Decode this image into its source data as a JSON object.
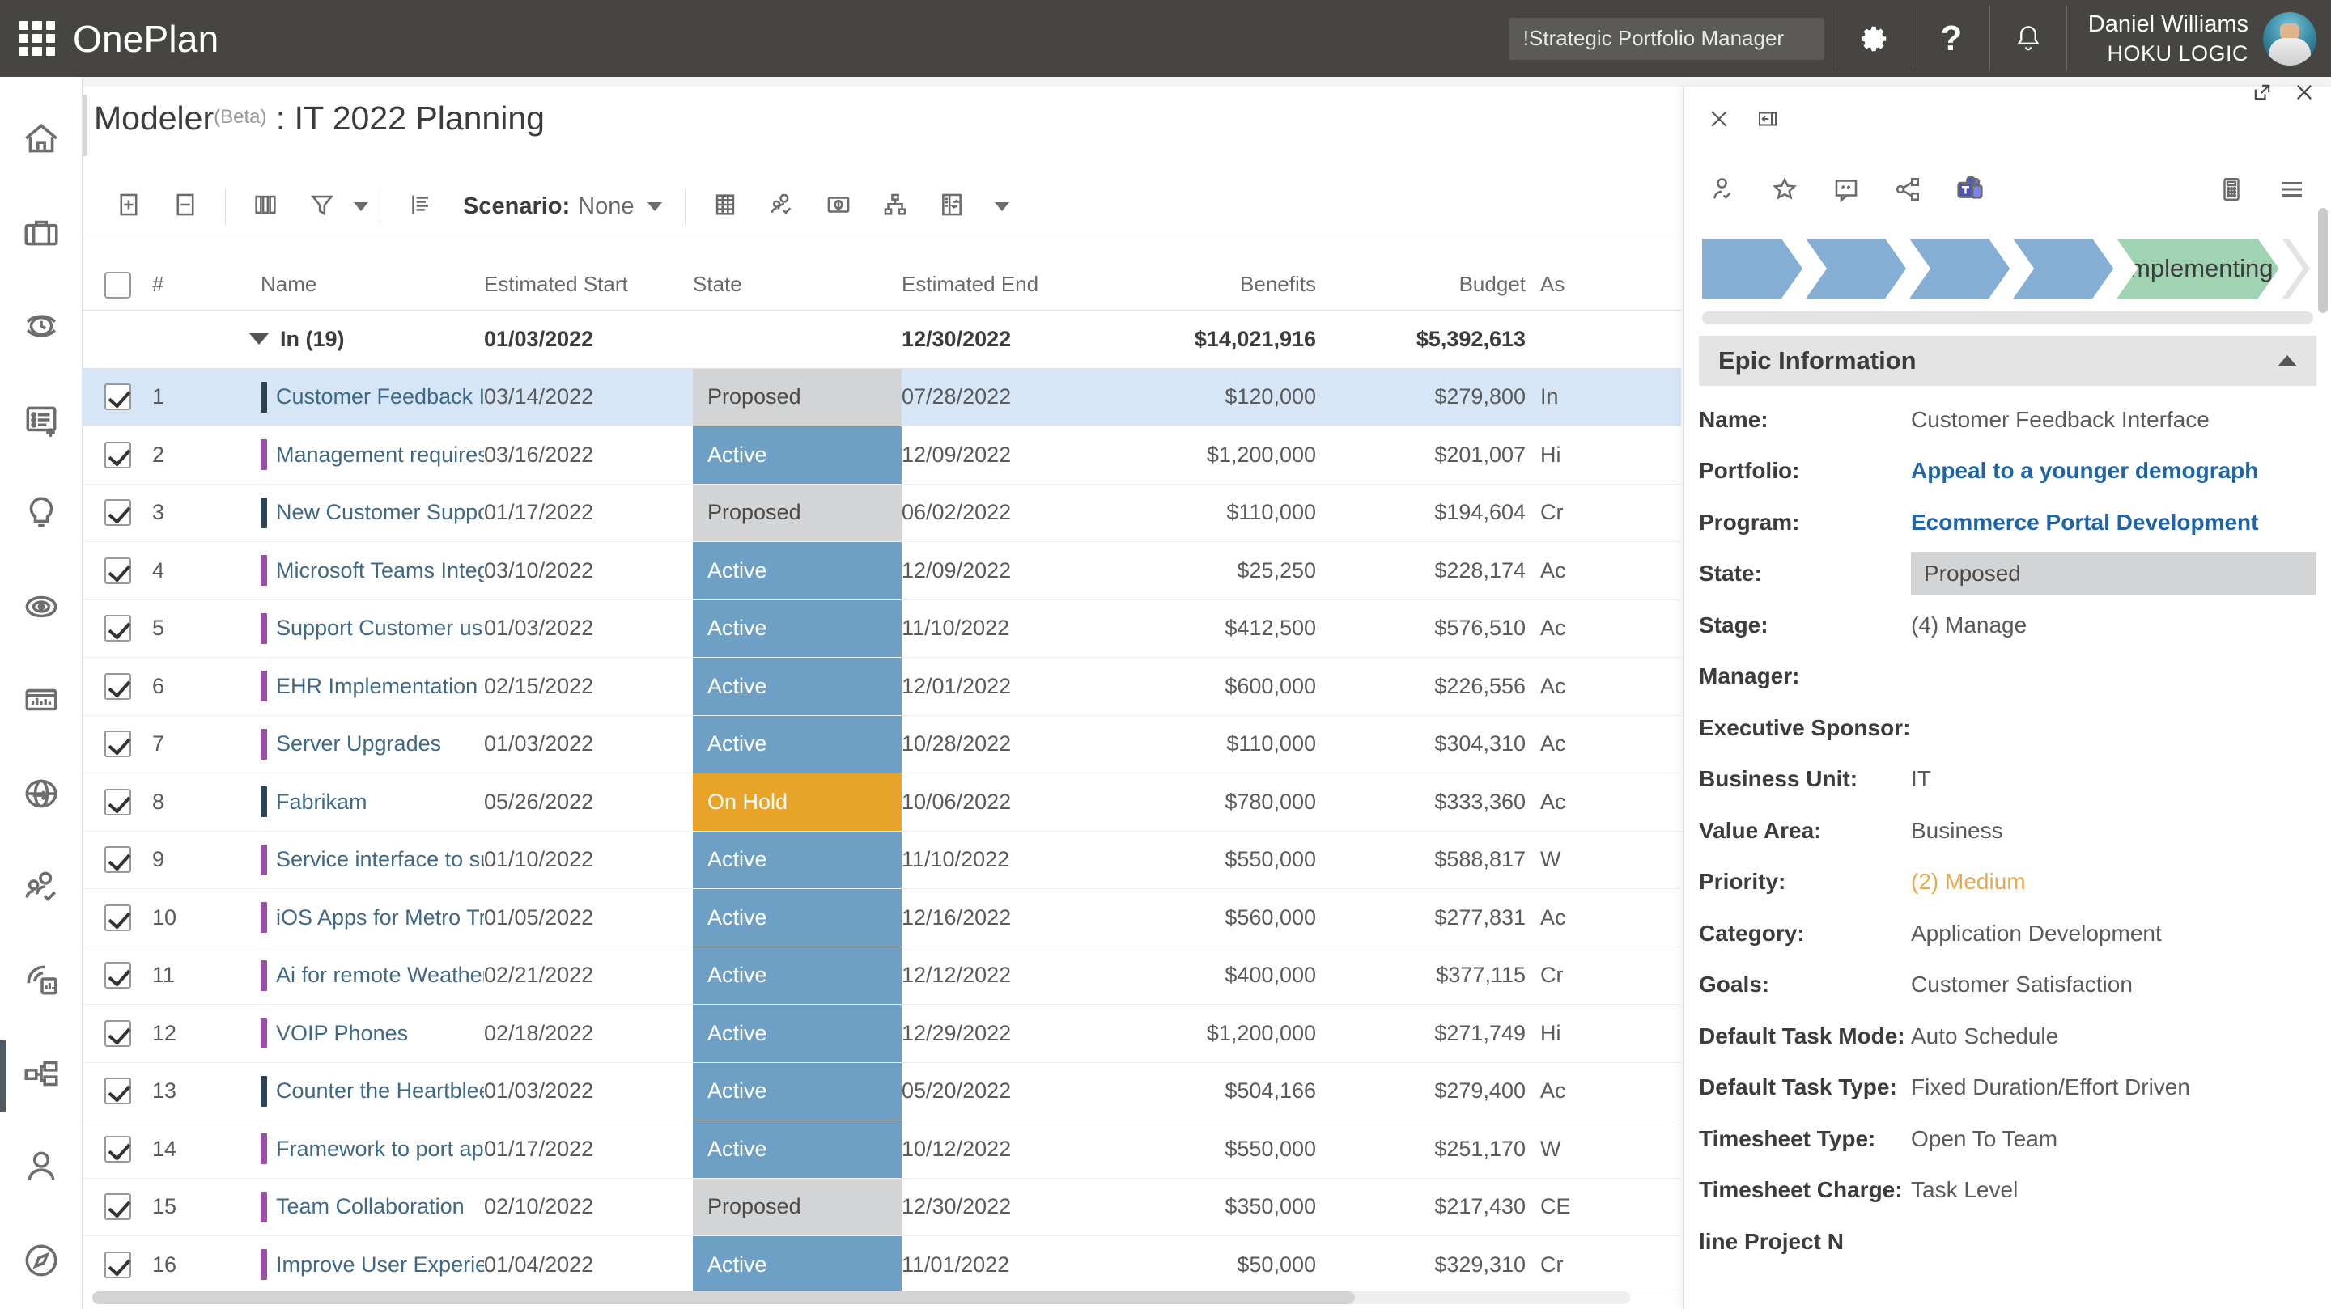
{
  "appbar": {
    "brand": "OnePlan",
    "waffle_icon": "app-launcher-icon",
    "portfolio_selector": "!Strategic Portfolio Manager",
    "settings_icon": "gear-icon",
    "help_icon": "question-mark-icon",
    "notifications_icon": "bell-icon",
    "user_name": "Daniel Williams",
    "user_org": "HOKU LOGIC",
    "avatar_icon": "user-avatar"
  },
  "rail": {
    "items": [
      {
        "name": "home",
        "icon": "home-icon",
        "active": false
      },
      {
        "name": "portfolio",
        "icon": "briefcase-icon",
        "active": false
      },
      {
        "name": "timesheet",
        "icon": "clock-icon",
        "active": false
      },
      {
        "name": "new-work",
        "icon": "list-plus-icon",
        "active": false
      },
      {
        "name": "ideas",
        "icon": "lightbulb-icon",
        "active": false
      },
      {
        "name": "goals",
        "icon": "target-icon",
        "active": false
      },
      {
        "name": "reports",
        "icon": "bar-chart-icon",
        "active": false
      },
      {
        "name": "integrations",
        "icon": "globe-arrow-icon",
        "active": false
      },
      {
        "name": "resources",
        "icon": "people-check-icon",
        "active": false
      },
      {
        "name": "powerbi",
        "icon": "powerbi-report-icon",
        "active": false
      },
      {
        "name": "modeler",
        "icon": "modeler-nodes-icon",
        "active": true
      },
      {
        "name": "my-profile",
        "icon": "person-icon",
        "active": false
      },
      {
        "name": "admin",
        "icon": "compass-icon",
        "active": false
      }
    ]
  },
  "window": {
    "title_main": "Modeler",
    "title_beta": "(Beta)",
    "title_sep": " : ",
    "title_plan": "IT 2022 Planning",
    "popout_icon": "popout-icon",
    "close_icon": "close-icon"
  },
  "toolbar": {
    "buttons": [
      {
        "name": "expand-all-button",
        "icon": "plus-box-icon"
      },
      {
        "name": "collapse-all-button",
        "icon": "minus-box-icon"
      },
      {
        "name": "columns-button",
        "icon": "columns-icon"
      },
      {
        "name": "filter-button",
        "icon": "funnel-icon"
      },
      {
        "name": "filter-dropdown",
        "icon": "chevron-down-icon"
      },
      {
        "name": "group-button",
        "icon": "group-lines-icon"
      }
    ],
    "scenario_label": "Scenario:",
    "scenario_value": "None",
    "scenario_caret": "chevron-down-icon",
    "right_buttons": [
      {
        "name": "grid-view-button",
        "icon": "table-grid-icon"
      },
      {
        "name": "resource-plan-button",
        "icon": "person-check-icon"
      },
      {
        "name": "cost-plan-button",
        "icon": "money-icon"
      },
      {
        "name": "hierarchy-button",
        "icon": "org-chart-icon"
      },
      {
        "name": "compare-button",
        "icon": "compare-panel-icon"
      },
      {
        "name": "more-button",
        "icon": "chevron-down-icon"
      }
    ]
  },
  "grid": {
    "columns": [
      "",
      "#",
      "Name",
      "Estimated Start",
      "State",
      "Estimated End",
      "Benefits",
      "Budget",
      "As"
    ],
    "summary": {
      "label": "In (19)",
      "estimated_start": "01/03/2022",
      "state": "",
      "estimated_end": "12/30/2022",
      "benefits": "$14,021,916",
      "budget": "$5,392,613",
      "extra": ""
    },
    "rows": [
      {
        "num": "1",
        "bar": "#2d4356",
        "name": "Customer Feedback Inte",
        "start": "03/14/2022",
        "state": "Proposed",
        "state_class": "st-proposed",
        "end": "07/28/2022",
        "benefits": "$120,000",
        "budget": "$279,800",
        "extra": "In",
        "selected": true,
        "checked": true
      },
      {
        "num": "2",
        "bar": "#9b4ea8",
        "name": "Management requires a",
        "start": "03/16/2022",
        "state": "Active",
        "state_class": "st-active",
        "end": "12/09/2022",
        "benefits": "$1,200,000",
        "budget": "$201,007",
        "extra": "Hi",
        "selected": false,
        "checked": true
      },
      {
        "num": "3",
        "bar": "#2d4356",
        "name": "New Customer Support",
        "start": "01/17/2022",
        "state": "Proposed",
        "state_class": "st-proposed",
        "end": "06/02/2022",
        "benefits": "$110,000",
        "budget": "$194,604",
        "extra": "Cr",
        "selected": false,
        "checked": true
      },
      {
        "num": "4",
        "bar": "#9b4ea8",
        "name": "Microsoft Teams Integra",
        "start": "03/10/2022",
        "state": "Active",
        "state_class": "st-active",
        "end": "12/09/2022",
        "benefits": "$25,250",
        "budget": "$228,174",
        "extra": "Ac",
        "selected": false,
        "checked": true
      },
      {
        "num": "5",
        "bar": "#9b4ea8",
        "name": "Support Customer usin",
        "start": "01/03/2022",
        "state": "Active",
        "state_class": "st-active",
        "end": "11/10/2022",
        "benefits": "$412,500",
        "budget": "$576,510",
        "extra": "Ac",
        "selected": false,
        "checked": true
      },
      {
        "num": "6",
        "bar": "#9b4ea8",
        "name": "EHR Implementation",
        "start": "02/15/2022",
        "state": "Active",
        "state_class": "st-active",
        "end": "12/01/2022",
        "benefits": "$600,000",
        "budget": "$226,556",
        "extra": "Ac",
        "selected": false,
        "checked": true
      },
      {
        "num": "7",
        "bar": "#9b4ea8",
        "name": "Server Upgrades",
        "start": "01/03/2022",
        "state": "Active",
        "state_class": "st-active",
        "end": "10/28/2022",
        "benefits": "$110,000",
        "budget": "$304,310",
        "extra": "Ac",
        "selected": false,
        "checked": true
      },
      {
        "num": "8",
        "bar": "#2d4356",
        "name": "Fabrikam",
        "start": "05/26/2022",
        "state": "On Hold",
        "state_class": "st-onhold",
        "end": "10/06/2022",
        "benefits": "$780,000",
        "budget": "$333,360",
        "extra": "Ac",
        "selected": false,
        "checked": true
      },
      {
        "num": "9",
        "bar": "#9b4ea8",
        "name": "Service interface to sup",
        "start": "01/10/2022",
        "state": "Active",
        "state_class": "st-active",
        "end": "11/10/2022",
        "benefits": "$550,000",
        "budget": "$588,817",
        "extra": "W",
        "selected": false,
        "checked": true
      },
      {
        "num": "10",
        "bar": "#9b4ea8",
        "name": "iOS Apps for Metro Trar",
        "start": "01/05/2022",
        "state": "Active",
        "state_class": "st-active",
        "end": "12/16/2022",
        "benefits": "$560,000",
        "budget": "$277,831",
        "extra": "Ac",
        "selected": false,
        "checked": true
      },
      {
        "num": "11",
        "bar": "#9b4ea8",
        "name": "Ai for remote Weather S",
        "start": "02/21/2022",
        "state": "Active",
        "state_class": "st-active",
        "end": "12/12/2022",
        "benefits": "$400,000",
        "budget": "$377,115",
        "extra": "Cr",
        "selected": false,
        "checked": true
      },
      {
        "num": "12",
        "bar": "#9b4ea8",
        "name": "VOIP Phones",
        "start": "02/18/2022",
        "state": "Active",
        "state_class": "st-active",
        "end": "12/29/2022",
        "benefits": "$1,200,000",
        "budget": "$271,749",
        "extra": "Hi",
        "selected": false,
        "checked": true
      },
      {
        "num": "13",
        "bar": "#2d4356",
        "name": "Counter the Heartbleed",
        "start": "01/03/2022",
        "state": "Active",
        "state_class": "st-active",
        "end": "05/20/2022",
        "benefits": "$504,166",
        "budget": "$279,400",
        "extra": "Ac",
        "selected": false,
        "checked": true
      },
      {
        "num": "14",
        "bar": "#9b4ea8",
        "name": "Framework to port appl",
        "start": "01/17/2022",
        "state": "Active",
        "state_class": "st-active",
        "end": "10/12/2022",
        "benefits": "$550,000",
        "budget": "$251,170",
        "extra": "W",
        "selected": false,
        "checked": true
      },
      {
        "num": "15",
        "bar": "#9b4ea8",
        "name": "Team Collaboration",
        "start": "02/10/2022",
        "state": "Proposed",
        "state_class": "st-proposed",
        "end": "12/30/2022",
        "benefits": "$350,000",
        "budget": "$217,430",
        "extra": "CE",
        "selected": false,
        "checked": true
      },
      {
        "num": "16",
        "bar": "#9b4ea8",
        "name": "Improve User Experienc",
        "start": "01/04/2022",
        "state": "Active",
        "state_class": "st-active",
        "end": "11/01/2022",
        "benefits": "$50,000",
        "budget": "$329,310",
        "extra": "Cr",
        "selected": false,
        "checked": true
      }
    ]
  },
  "detail": {
    "close_icon": "close-icon",
    "collapse_icon": "collapse-panel-icon",
    "icons": [
      {
        "name": "assign-user-icon"
      },
      {
        "name": "favorite-star-icon"
      },
      {
        "name": "comments-icon"
      },
      {
        "name": "share-icon"
      },
      {
        "name": "microsoft-teams-icon"
      },
      {
        "name": "calculator-icon"
      },
      {
        "name": "menu-hamburger-icon"
      }
    ],
    "stages": [
      {
        "label": "",
        "color": "blue"
      },
      {
        "label": "",
        "color": "blue"
      },
      {
        "label": "",
        "color": "blue"
      },
      {
        "label": "",
        "color": "blue"
      },
      {
        "label": "Implementing",
        "color": "green"
      },
      {
        "label": "",
        "color": "grey"
      }
    ],
    "section_title": "Epic Information",
    "section_toggle_icon": "chevron-up-icon",
    "fields": [
      {
        "label": "Name:",
        "value": "Customer Feedback Interface",
        "style": "plain"
      },
      {
        "label": "Portfolio:",
        "value": "Appeal to a younger demograph",
        "style": "link"
      },
      {
        "label": "Program:",
        "value": "Ecommerce Portal Development",
        "style": "link"
      },
      {
        "label": "State:",
        "value": "Proposed",
        "style": "chip"
      },
      {
        "label": "Stage:",
        "value": "(4) Manage",
        "style": "plain"
      },
      {
        "label": "Manager:",
        "value": "",
        "style": "plain"
      },
      {
        "label": "Executive Sponsor:",
        "value": "",
        "style": "plain"
      },
      {
        "label": "Business Unit:",
        "value": "IT",
        "style": "plain"
      },
      {
        "label": "Value Area:",
        "value": "Business",
        "style": "plain"
      },
      {
        "label": "Priority:",
        "value": "(2) Medium",
        "style": "warn"
      },
      {
        "label": "Category:",
        "value": "Application Development",
        "style": "plain"
      },
      {
        "label": "Goals:",
        "value": "Customer Satisfaction",
        "style": "plain"
      },
      {
        "label": "Default Task Mode:",
        "value": "Auto Schedule",
        "style": "plain"
      },
      {
        "label": "Default Task Type:",
        "value": "Fixed Duration/Effort Driven",
        "style": "plain"
      },
      {
        "label": "Timesheet Type:",
        "value": "Open To Team",
        "style": "plain"
      },
      {
        "label": "Timesheet Charge:",
        "value": "Task Level",
        "style": "plain"
      },
      {
        "label": "line Project N",
        "value": "",
        "style": "cut"
      }
    ]
  }
}
